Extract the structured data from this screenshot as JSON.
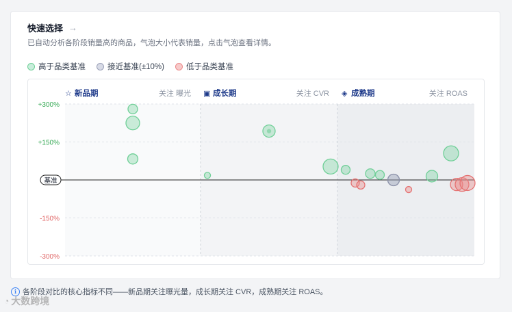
{
  "header": {
    "title": "快速选择",
    "subtitle": "已自动分析各阶段销量高的商品，气泡大小代表销量，点击气泡查看详情。"
  },
  "legend": [
    {
      "label": "高于品类基准",
      "fill": "#c9eedc",
      "stroke": "#6fcf97"
    },
    {
      "label": "接近基准(±10%)",
      "fill": "#d8dbe6",
      "stroke": "#9aa0b8"
    },
    {
      "label": "低于品类基准",
      "fill": "#f7caca",
      "stroke": "#ec8a8a"
    }
  ],
  "footer": {
    "note": "各阶段对比的核心指标不同——新品期关注曝光量，成长期关注 CVR，成熟期关注 ROAS。"
  },
  "watermark": {
    "text": "大数跨境"
  },
  "colors": {
    "above": "#6fcf97",
    "near": "#9aa0b8",
    "below": "#ec8a8a",
    "accent": "#1e3a8a"
  },
  "chart_data": {
    "type": "scatter",
    "y_ticks": [
      {
        "value": 300,
        "label": "+300%",
        "tone": "pos"
      },
      {
        "value": 150,
        "label": "+150%",
        "tone": "pos"
      },
      {
        "value": 0,
        "label": "基准",
        "tone": "base"
      },
      {
        "value": -150,
        "label": "-150%",
        "tone": "neg"
      },
      {
        "value": -300,
        "label": "-300%",
        "tone": "neg"
      }
    ],
    "ylim": [
      -300,
      300
    ],
    "grid": true,
    "panels": [
      {
        "name": "新品期",
        "icon": "star-icon",
        "metric": "关注 曝光",
        "points": [
          {
            "x": 0.5,
            "y": 280,
            "size": 14,
            "status": "above"
          },
          {
            "x": 0.5,
            "y": 225,
            "size": 20,
            "status": "above"
          },
          {
            "x": 0.5,
            "y": 83,
            "size": 15,
            "status": "above"
          }
        ]
      },
      {
        "name": "成长期",
        "icon": "shop-icon",
        "metric": "关注 CVR",
        "points": [
          {
            "x": 0.05,
            "y": 18,
            "size": 9,
            "status": "above"
          },
          {
            "x": 0.5,
            "y": 193,
            "size": 18,
            "status": "above"
          }
        ]
      },
      {
        "name": "成熟期",
        "icon": "shield-icon",
        "metric": "关注 ROAS",
        "points": [
          {
            "x": -0.05,
            "y": 53,
            "size": 22,
            "status": "above"
          },
          {
            "x": 0.06,
            "y": 40,
            "size": 13,
            "status": "above"
          },
          {
            "x": 0.13,
            "y": -12,
            "size": 12,
            "status": "below"
          },
          {
            "x": 0.17,
            "y": -20,
            "size": 12,
            "status": "below"
          },
          {
            "x": 0.24,
            "y": 25,
            "size": 14,
            "status": "above"
          },
          {
            "x": 0.31,
            "y": 20,
            "size": 13,
            "status": "above"
          },
          {
            "x": 0.41,
            "y": 0,
            "size": 17,
            "status": "near"
          },
          {
            "x": 0.52,
            "y": -38,
            "size": 9,
            "status": "below"
          },
          {
            "x": 0.69,
            "y": 15,
            "size": 17,
            "status": "above"
          },
          {
            "x": 0.83,
            "y": 105,
            "size": 22,
            "status": "above"
          },
          {
            "x": 0.87,
            "y": -18,
            "size": 18,
            "status": "below"
          },
          {
            "x": 0.91,
            "y": -18,
            "size": 20,
            "status": "below"
          },
          {
            "x": 0.95,
            "y": -12,
            "size": 22,
            "status": "below"
          }
        ]
      }
    ]
  }
}
